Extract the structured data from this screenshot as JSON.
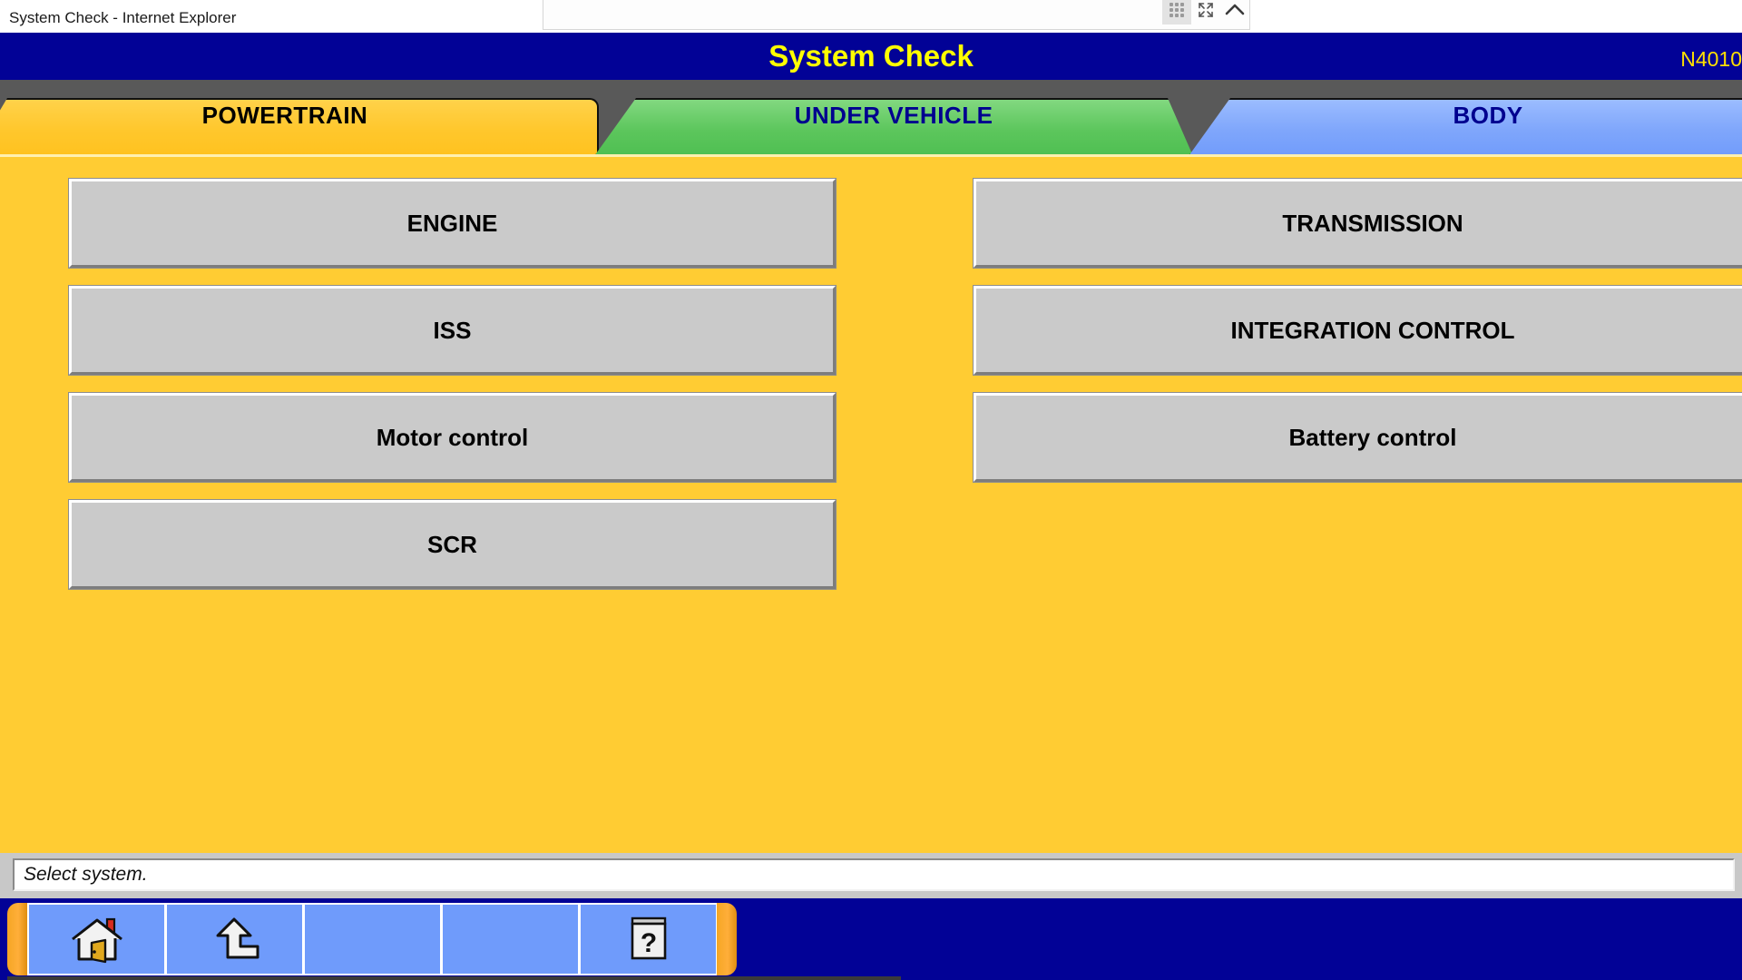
{
  "browser": {
    "title": "System Check - Internet Explorer",
    "toolbar": {
      "grip_icon": "grid-handle-icon",
      "fullscreen_icon": "expand-icon",
      "collapse_icon": "chevron-up-icon"
    }
  },
  "header": {
    "title": "System Check",
    "code": "N4010",
    "bg_color": "#020296",
    "title_color": "#ffff00"
  },
  "tabs": [
    {
      "label": "POWERTRAIN",
      "color": "#ffc72c",
      "text_color": "#000000",
      "selected": true
    },
    {
      "label": "UNDER VEHICLE",
      "color": "#5cc65c",
      "text_color": "#00008f",
      "selected": false
    },
    {
      "label": "BODY",
      "color": "#7fa6fb",
      "text_color": "#00008f",
      "selected": false
    }
  ],
  "content": {
    "bg_color": "#ffcc33",
    "left_column": [
      {
        "label": "ENGINE"
      },
      {
        "label": "ISS"
      },
      {
        "label": "Motor control"
      },
      {
        "label": "SCR"
      }
    ],
    "right_column": [
      {
        "label": "TRANSMISSION"
      },
      {
        "label": "INTEGRATION CONTROL"
      },
      {
        "label": "Battery control"
      }
    ]
  },
  "status": {
    "message": "Select system."
  },
  "bottom_toolbar": {
    "buttons": [
      {
        "icon": "home-icon",
        "label": ""
      },
      {
        "icon": "back-up-arrow-icon",
        "label": ""
      },
      {
        "icon": "",
        "label": ""
      },
      {
        "icon": "",
        "label": ""
      },
      {
        "icon": "help-book-icon",
        "label": ""
      }
    ]
  }
}
